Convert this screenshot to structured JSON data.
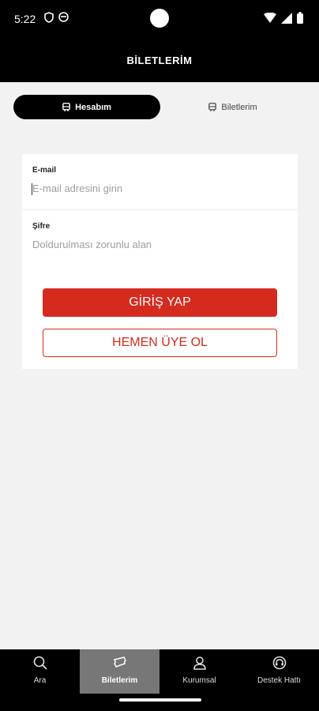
{
  "status_bar": {
    "time": "5:22"
  },
  "header": {
    "title": "BİLETLERİM"
  },
  "tabs": {
    "active_label": "Hesabım",
    "inactive_label": "Biletlerim"
  },
  "form": {
    "email": {
      "label": "E-mail",
      "placeholder": "E-mail adresini girin",
      "value": ""
    },
    "password": {
      "label": "Şifre",
      "placeholder": "Doldurulması zorunlu alan",
      "value": ""
    },
    "login_label": "GİRİŞ YAP",
    "signup_label": "HEMEN ÜYE OL"
  },
  "bottom_nav": {
    "items": [
      {
        "label": "Ara",
        "icon": "search-icon"
      },
      {
        "label": "Biletlerim",
        "icon": "ticket-icon",
        "active": true
      },
      {
        "label": "Kurumsal",
        "icon": "person-icon"
      },
      {
        "label": "Destek Hattı",
        "icon": "support-icon"
      }
    ]
  },
  "colors": {
    "accent": "#d52b1e",
    "bar": "#000000",
    "background": "#f2f2f2",
    "nav_active": "#777777"
  }
}
